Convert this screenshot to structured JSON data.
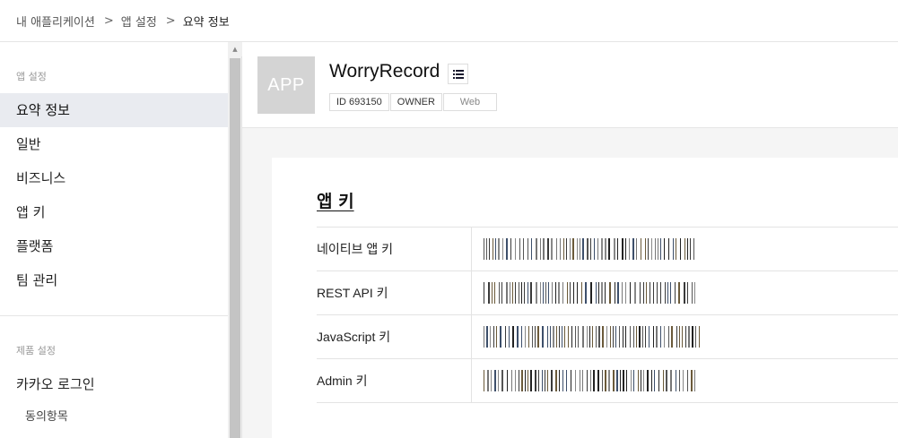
{
  "breadcrumb": [
    "내 애플리케이션",
    "앱 설정",
    "요약 정보"
  ],
  "breadcrumb_separator": ">",
  "sidebar": {
    "app_settings_label": "앱 설정",
    "items": [
      {
        "label": "요약 정보",
        "active": true
      },
      {
        "label": "일반"
      },
      {
        "label": "비즈니스"
      },
      {
        "label": "앱 키"
      },
      {
        "label": "플랫폼"
      },
      {
        "label": "팀 관리"
      }
    ],
    "product_settings_label": "제품 설정",
    "product_items": [
      {
        "label": "카카오 로그인"
      }
    ],
    "product_sub_items": [
      {
        "label": "동의항목"
      }
    ]
  },
  "app": {
    "icon_text": "APP",
    "name": "WorryRecord",
    "tags": [
      "ID 693150",
      "OWNER",
      "Web"
    ]
  },
  "app_keys": {
    "title": "앱 키",
    "rows": [
      {
        "label": "네이티브 앱 키"
      },
      {
        "label": "REST API 키"
      },
      {
        "label": "JavaScript 키"
      },
      {
        "label": "Admin 키"
      }
    ]
  },
  "colors": {
    "active_nav_bg": "#e9ebf0",
    "app_icon_bg": "#d4d4d4",
    "main_bg": "#f5f5f5"
  },
  "icons": {
    "menu": "list-icon",
    "scroll_up": "triangle-up-icon"
  }
}
